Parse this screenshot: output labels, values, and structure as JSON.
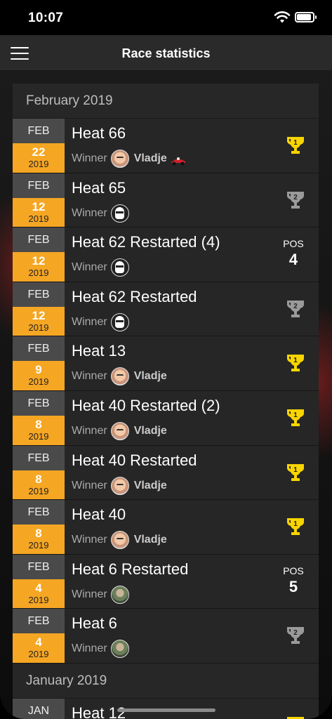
{
  "status_bar": {
    "time": "10:07"
  },
  "nav": {
    "title": "Race statistics"
  },
  "colors": {
    "accent": "#f5a623",
    "gold": "#f8d500",
    "silver": "#9a9a9a"
  },
  "sections": [
    {
      "title": "February 2019",
      "rows": [
        {
          "month": "FEB",
          "day": "22",
          "year": "2019",
          "title": "Heat 66",
          "winner_label": "Winner",
          "winner_avatar": "face",
          "winner_name": "Vladje",
          "kart_icon": true,
          "result": {
            "type": "trophy",
            "rank": "1"
          }
        },
        {
          "month": "FEB",
          "day": "12",
          "year": "2019",
          "title": "Heat 65",
          "winner_label": "Winner",
          "winner_avatar": "helmet",
          "winner_name": "",
          "kart_icon": false,
          "result": {
            "type": "trophy",
            "rank": "2"
          }
        },
        {
          "month": "FEB",
          "day": "12",
          "year": "2019",
          "title": "Heat 62 Restarted (4)",
          "winner_label": "Winner",
          "winner_avatar": "helmet",
          "winner_name": "",
          "kart_icon": false,
          "result": {
            "type": "pos",
            "label": "POS",
            "value": "4"
          }
        },
        {
          "month": "FEB",
          "day": "12",
          "year": "2019",
          "title": "Heat 62 Restarted",
          "winner_label": "Winner",
          "winner_avatar": "helmet",
          "winner_name": "",
          "kart_icon": false,
          "result": {
            "type": "trophy",
            "rank": "2"
          }
        },
        {
          "month": "FEB",
          "day": "9",
          "year": "2019",
          "title": "Heat 13",
          "winner_label": "Winner",
          "winner_avatar": "face",
          "winner_name": "Vladje",
          "kart_icon": false,
          "result": {
            "type": "trophy",
            "rank": "1"
          }
        },
        {
          "month": "FEB",
          "day": "8",
          "year": "2019",
          "title": "Heat 40 Restarted (2)",
          "winner_label": "Winner",
          "winner_avatar": "face",
          "winner_name": "Vladje",
          "kart_icon": false,
          "result": {
            "type": "trophy",
            "rank": "1"
          }
        },
        {
          "month": "FEB",
          "day": "8",
          "year": "2019",
          "title": "Heat 40 Restarted",
          "winner_label": "Winner",
          "winner_avatar": "face",
          "winner_name": "Vladje",
          "kart_icon": false,
          "result": {
            "type": "trophy",
            "rank": "1"
          }
        },
        {
          "month": "FEB",
          "day": "8",
          "year": "2019",
          "title": "Heat 40",
          "winner_label": "Winner",
          "winner_avatar": "face",
          "winner_name": "Vladje",
          "kart_icon": false,
          "result": {
            "type": "trophy",
            "rank": "1"
          }
        },
        {
          "month": "FEB",
          "day": "4",
          "year": "2019",
          "title": "Heat 6 Restarted",
          "winner_label": "Winner",
          "winner_avatar": "photo",
          "winner_name": "",
          "kart_icon": false,
          "result": {
            "type": "pos",
            "label": "POS",
            "value": "5"
          }
        },
        {
          "month": "FEB",
          "day": "4",
          "year": "2019",
          "title": "Heat 6",
          "winner_label": "Winner",
          "winner_avatar": "photo",
          "winner_name": "",
          "kart_icon": false,
          "result": {
            "type": "trophy",
            "rank": "2"
          }
        }
      ]
    },
    {
      "title": "January 2019",
      "rows": [
        {
          "month": "JAN",
          "day": "",
          "year": "",
          "title": "Heat 12",
          "winner_label": "",
          "winner_avatar": "",
          "winner_name": "",
          "kart_icon": false,
          "result": {
            "type": "trophy",
            "rank": "1"
          }
        }
      ]
    }
  ]
}
